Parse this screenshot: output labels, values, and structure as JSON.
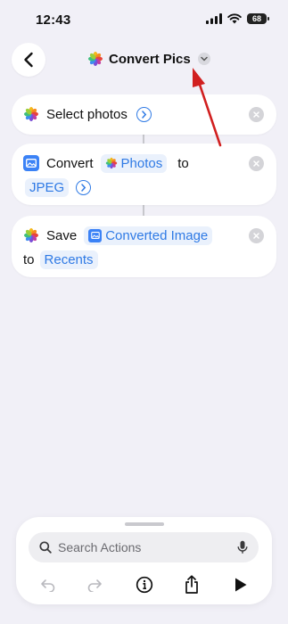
{
  "status_bar": {
    "time": "12:43",
    "battery": "68"
  },
  "header": {
    "title": "Convert Pics"
  },
  "actions": [
    {
      "prefix": "Select photos"
    },
    {
      "verb": "Convert",
      "input_token": "Photos",
      "joiner": "to",
      "format_token": "JPEG"
    },
    {
      "verb": "Save",
      "input_token": "Converted Image",
      "joiner": "to",
      "album_token": "Recents"
    }
  ],
  "bottom": {
    "search_placeholder": "Search Actions"
  },
  "colors": {
    "accent": "#2f7ae5",
    "annotation": "#d11f1f",
    "background": "#f1f0f7"
  },
  "icons": [
    "chevron-left-icon",
    "photos-app-icon",
    "chevron-down-icon",
    "circle-chevron-right-icon",
    "remove-icon",
    "photo-icon",
    "search-icon",
    "microphone-icon",
    "undo-icon",
    "redo-icon",
    "info-icon",
    "share-icon",
    "play-icon"
  ]
}
